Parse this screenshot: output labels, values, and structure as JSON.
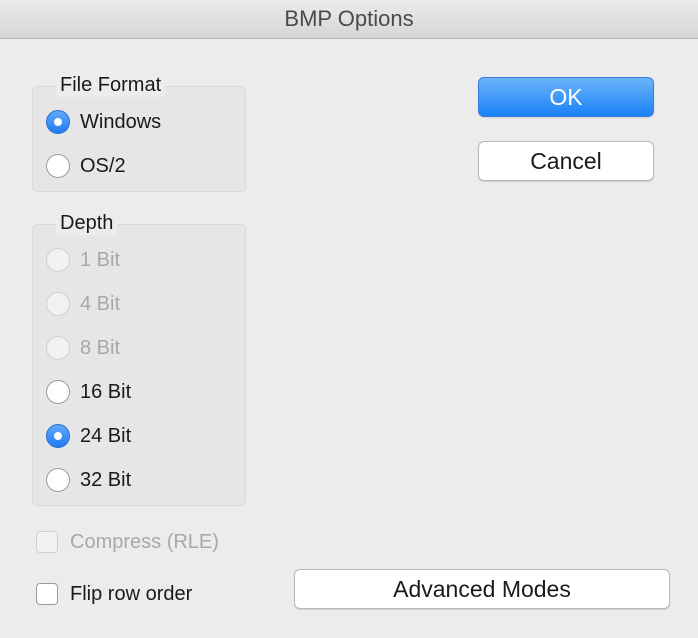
{
  "window": {
    "title": "BMP Options"
  },
  "file_format": {
    "label": "File Format",
    "options": [
      {
        "label": "Windows",
        "selected": true,
        "enabled": true
      },
      {
        "label": "OS/2",
        "selected": false,
        "enabled": true
      }
    ]
  },
  "depth": {
    "label": "Depth",
    "options": [
      {
        "label": "1 Bit",
        "selected": false,
        "enabled": false
      },
      {
        "label": "4 Bit",
        "selected": false,
        "enabled": false
      },
      {
        "label": "8 Bit",
        "selected": false,
        "enabled": false
      },
      {
        "label": "16 Bit",
        "selected": false,
        "enabled": true
      },
      {
        "label": "24 Bit",
        "selected": true,
        "enabled": true
      },
      {
        "label": "32 Bit",
        "selected": false,
        "enabled": true
      }
    ]
  },
  "compress": {
    "label": "Compress (RLE)",
    "checked": false,
    "enabled": false
  },
  "flip_rows": {
    "label": "Flip row order",
    "checked": false,
    "enabled": true
  },
  "buttons": {
    "ok": "OK",
    "cancel": "Cancel",
    "advanced": "Advanced Modes"
  },
  "colors": {
    "accent": "#1a82f7",
    "background": "#ececec"
  }
}
